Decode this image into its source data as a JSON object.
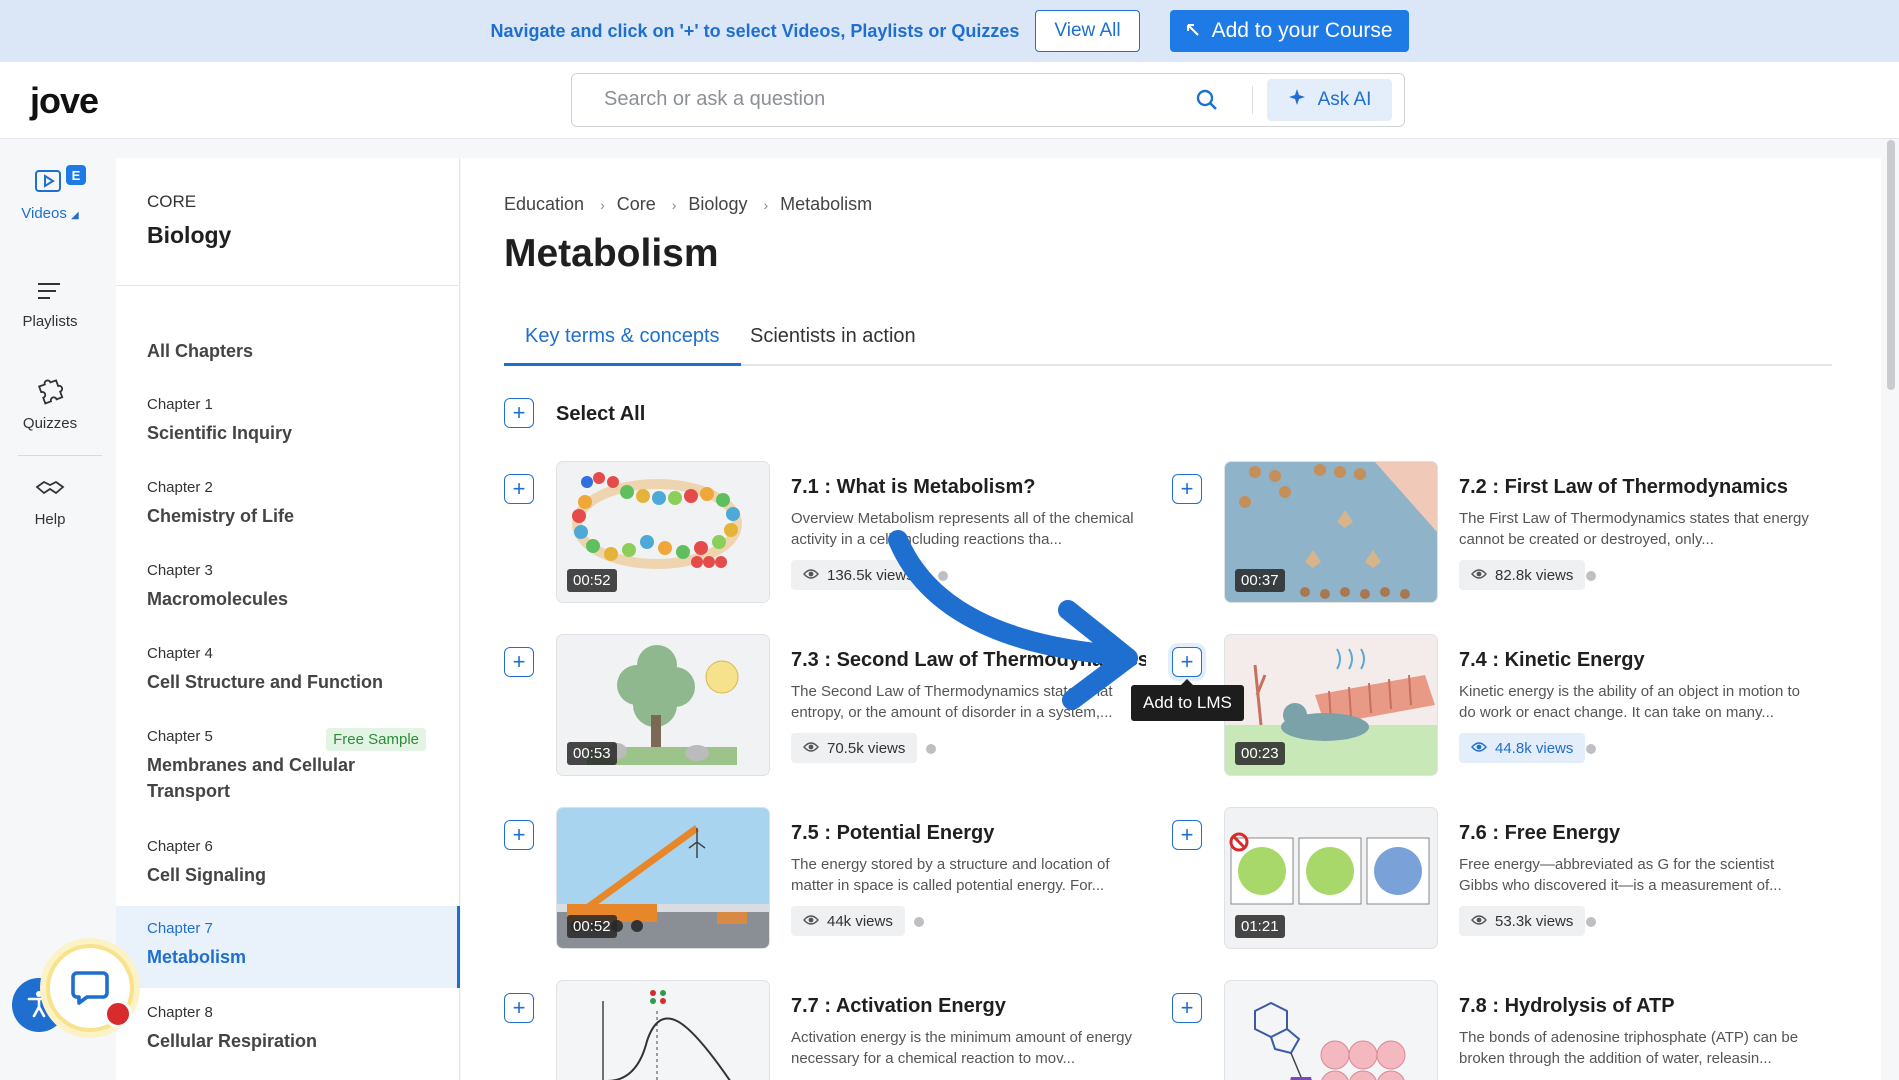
{
  "promo": {
    "text": "Navigate and click on '+' to select Videos, Playlists or Quizzes",
    "view_all": "View All",
    "add_course": "Add to your Course"
  },
  "header": {
    "logo": "jove",
    "search_placeholder": "Search or ask a question",
    "ask_ai": "Ask AI"
  },
  "rail": {
    "videos": "Videos",
    "badge": "E",
    "playlists": "Playlists",
    "quizzes": "Quizzes",
    "help": "Help"
  },
  "sidebar": {
    "core": "CORE",
    "subject": "Biology",
    "all_chapters": "All Chapters",
    "chapters": [
      {
        "num": "Chapter 1",
        "title": "Scientific Inquiry"
      },
      {
        "num": "Chapter 2",
        "title": "Chemistry of Life"
      },
      {
        "num": "Chapter 3",
        "title": "Macromolecules"
      },
      {
        "num": "Chapter 4",
        "title": "Cell Structure and Function"
      },
      {
        "num": "Chapter 5",
        "title": "Membranes and Cellular Transport",
        "badge": "Free Sample"
      },
      {
        "num": "Chapter 6",
        "title": "Cell Signaling"
      },
      {
        "num": "Chapter 7",
        "title": "Metabolism"
      },
      {
        "num": "Chapter 8",
        "title": "Cellular Respiration"
      }
    ]
  },
  "main": {
    "breadcrumb": [
      "Education",
      "Core",
      "Biology",
      "Metabolism"
    ],
    "title": "Metabolism",
    "tabs": [
      "Key terms & concepts",
      "Scientists in action"
    ],
    "select_all": "Select All",
    "tooltip": "Add to LMS",
    "cards": [
      {
        "title": "7.1 : What is Metabolism?",
        "desc": "Overview Metabolism represents all of the chemical activity in a cell, including reactions tha...",
        "views": "136.5k views",
        "duration": "00:52"
      },
      {
        "title": "7.2 : First Law of Thermodynamics",
        "desc": "The First Law of Thermodynamics states that energy cannot be created or destroyed, only...",
        "views": "82.8k views",
        "duration": "00:37"
      },
      {
        "title": "7.3 : Second Law of Thermodynamics",
        "desc": "The Second Law of Thermodynamics states that entropy, or the amount of disorder in a system,...",
        "views": "70.5k views",
        "duration": "00:53"
      },
      {
        "title": "7.4 : Kinetic Energy",
        "desc": "Kinetic energy is the ability of an object in motion to do work or enact change. It can take on many...",
        "views": "44.8k views",
        "duration": "00:23"
      },
      {
        "title": "7.5 : Potential Energy",
        "desc": "The energy stored by a structure and location of matter in space is called potential energy. For...",
        "views": "44k views",
        "duration": "00:52"
      },
      {
        "title": "7.6 : Free Energy",
        "desc": "Free energy—abbreviated as G for the scientist Gibbs who discovered it—is a measurement of...",
        "views": "53.3k views",
        "duration": "01:21"
      },
      {
        "title": "7.7 : Activation Energy",
        "desc": "Activation energy is the minimum amount of energy necessary for a chemical reaction to mov...",
        "views": "",
        "duration": ""
      },
      {
        "title": "7.8 : Hydrolysis of ATP",
        "desc": "The bonds of adenosine triphosphate (ATP) can be broken through the addition of water, releasin...",
        "views": "",
        "duration": ""
      }
    ]
  },
  "colors": {
    "accent": "#1e6fd0",
    "promo_bg": "#dbe7f6"
  }
}
